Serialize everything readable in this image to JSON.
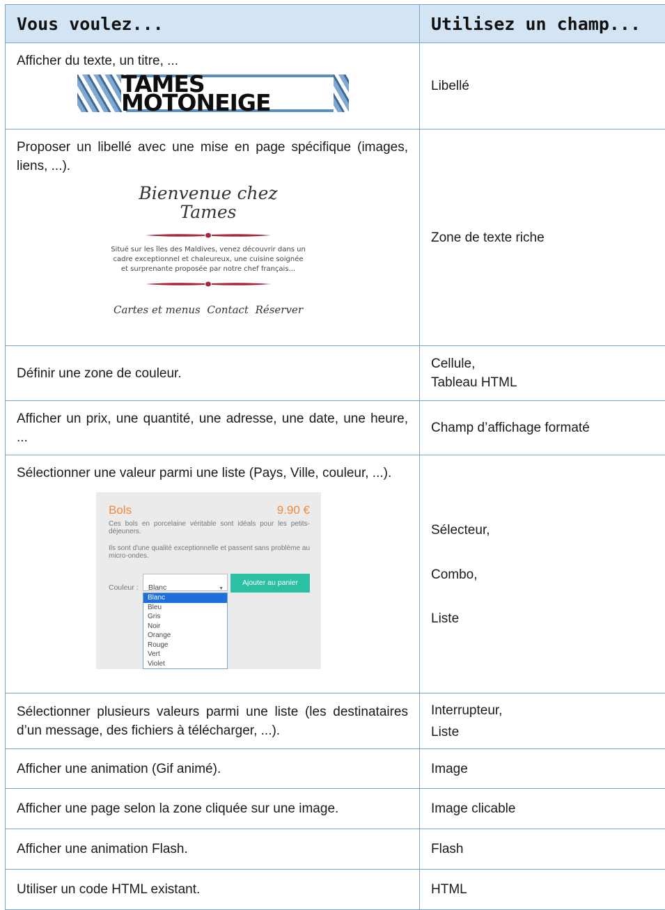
{
  "header": {
    "col1": "Vous voulez...",
    "col2": "Utilisez un champ..."
  },
  "rows": [
    {
      "want": "Afficher du texte, un titre, ...",
      "use": "Libellé"
    },
    {
      "want": "Proposer un libellé avec une mise en page spécifique (images, liens, ...).",
      "use": "Zone de texte riche"
    },
    {
      "want": "Définir une zone de couleur.",
      "use_lines": [
        "Cellule,",
        "Tableau HTML"
      ]
    },
    {
      "want": "Afficher un prix, une quantité, une adresse, une date, une heure, ...",
      "use": "Champ d’affichage formaté"
    },
    {
      "want": "Sélectionner une valeur parmi une liste (Pays, Ville, couleur, ...).",
      "use_lines": [
        "Sélecteur,",
        "Combo,",
        "Liste"
      ]
    },
    {
      "want": "Sélectionner plusieurs valeurs parmi une liste (les destinataires d’un message, des fichiers à télécharger, ...).",
      "use_lines": [
        "Interrupteur,",
        "Liste"
      ]
    },
    {
      "want": "Afficher une animation (Gif animé).",
      "use": "Image"
    },
    {
      "want": "Afficher une page selon la zone cliquée sur une image.",
      "use": "Image clicable"
    },
    {
      "want": "Afficher une animation Flash.",
      "use": "Flash"
    },
    {
      "want": "Utiliser un code HTML existant.",
      "use": "HTML"
    }
  ],
  "banner": {
    "text": "TAMES MOTONEIGE"
  },
  "rich": {
    "title": "Bienvenue chez Tames",
    "text": "Situé sur les îles des Maldives, venez découvrir dans un cadre exceptionnel et chaleureux, une cuisine soignée et surprenante proposée par notre chef français...",
    "links": [
      "Cartes et menus",
      "Contact",
      "Réserver"
    ],
    "accent": "#a8243c"
  },
  "card": {
    "name": "Bols",
    "price": "9.90 €",
    "desc1": "Ces bols en porcelaine véritable sont idéals pour les petits-déjeuners.",
    "desc2": "Ils sont d'une qualité exceptionnelle et passent sans problème au micro-ondes.",
    "color_label": "Couleur :",
    "selected": "Blanc",
    "button": "Ajouter au panier",
    "options": [
      "Blanc",
      "Bleu",
      "Gris",
      "Noir",
      "Orange",
      "Rouge",
      "Vert",
      "Violet"
    ],
    "accent": "#f08a3c",
    "button_color": "#2bbfa3"
  }
}
